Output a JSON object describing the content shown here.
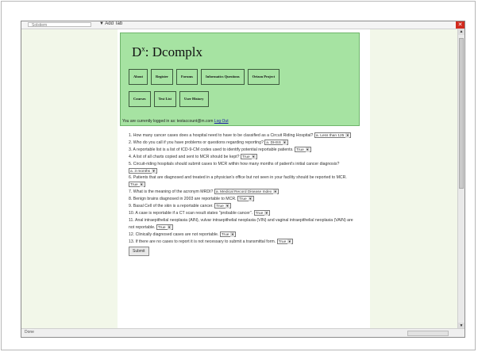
{
  "browser": {
    "search_text": "Solstiem",
    "add_tab_label": "▼ Add Tab",
    "close_glyph": "✕",
    "status_left": "Done"
  },
  "site": {
    "logo_prefix": "D",
    "logo_sup": "x",
    "logo_name": ": Dcomplx",
    "nav_row1": [
      "About",
      "Register",
      "Forums",
      "Informatics Questions",
      "Orizon Project"
    ],
    "nav_row2": [
      "Courses",
      "Test List",
      "User History"
    ],
    "logged_in_prefix": "You are currently logged in as: testaccount@m.com",
    "logout_label": "Log Out"
  },
  "quiz": {
    "questions": [
      {
        "text": "1. How many cancer cases does a hospital need to have to be classified as a Circuit Riding Hospital?",
        "answer": "a. Less than 125"
      },
      {
        "text": "2. Who do you call if you have problems or questions regarding reporting?",
        "answer": "a. DHSS"
      },
      {
        "text": "3. A reportable list is a list of ICD-9-CM codes used to identify potential reportable patients.",
        "answer": "True"
      },
      {
        "text": "4. A list of all charts copied and sent to MCR should be kept?",
        "answer": "True"
      },
      {
        "text": "5. Circuit-riding hospitals should submit cases to MCR within how many months of patient's initial cancer diagnosis?",
        "answer": "a. 3 months"
      },
      {
        "text": "6. Patients that are diagnosed and treated in a physician's office but not seen in your facility should be reported to MCR.",
        "answer": "True"
      },
      {
        "text": "7. What is the meaning of the acronym MRDI?",
        "answer": "a. Medical Record Disease Index"
      },
      {
        "text": "8. Benign brains diagnosed in 2003 are reportable to MCR.",
        "answer": "True"
      },
      {
        "text": "9. Basal Cell of the skin is a reportable cancer.",
        "answer": "True"
      },
      {
        "text": "10. A case is reportable if a CT scan result states \"probable cancer\".",
        "answer": "True"
      },
      {
        "text": "11. Anal intraepithelial neoplasia (AIN), vulvar intraepithelial neoplasia (VIN) and vaginal intraepithelial neoplasia (VAIN) are not reportable.",
        "answer": "True"
      },
      {
        "text": "12. Clinically diagnosed cases are not reportable.",
        "answer": "True"
      },
      {
        "text": "13. If there are no cases to report it is not necessary to submit a transmittal form.",
        "answer": "True"
      }
    ],
    "submit_label": "Submit"
  }
}
